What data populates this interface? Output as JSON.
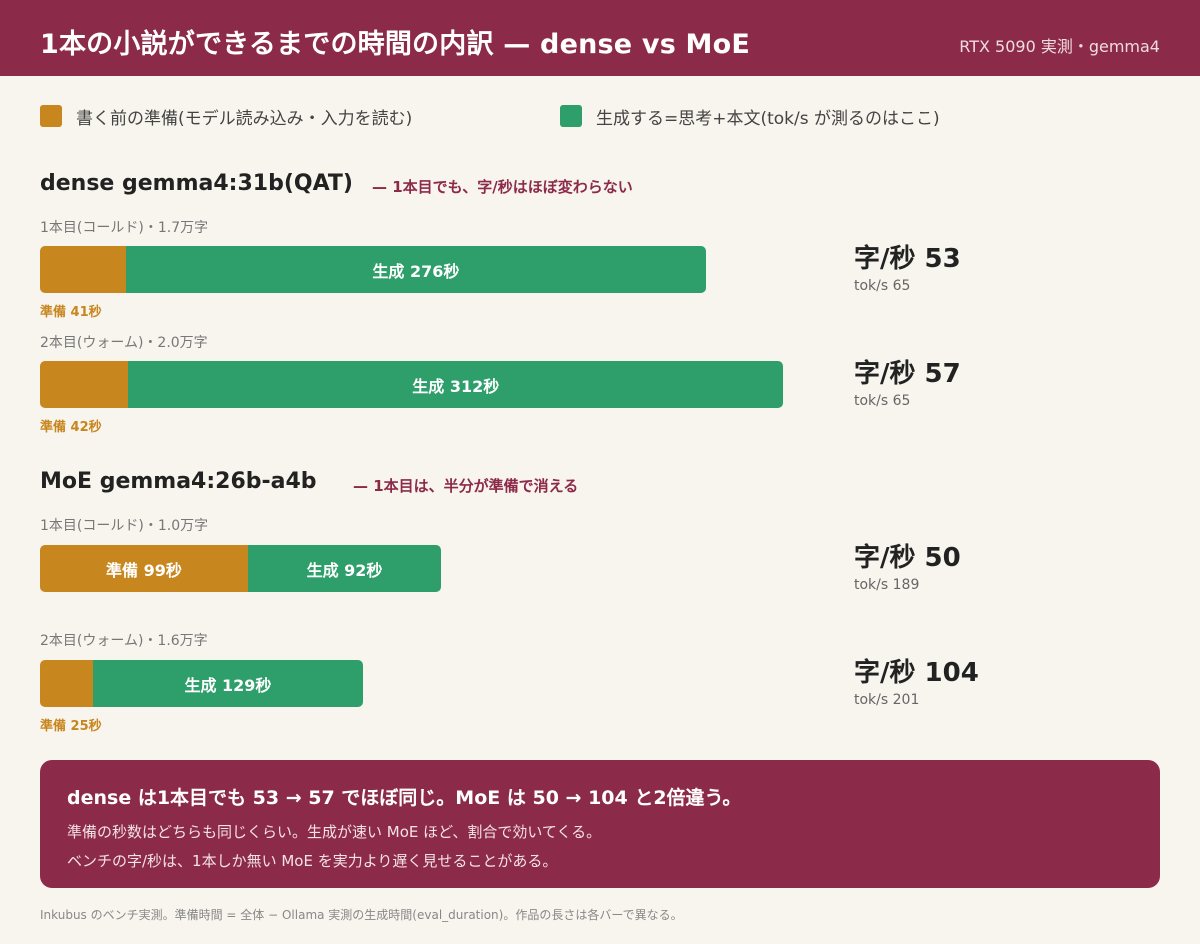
{
  "header": {
    "title": "1本の小説ができるまでの時間の内訳 — dense vs MoE",
    "subtitle": "RTX 5090 実測・gemma4"
  },
  "legend": {
    "prep_label": "書く前の準備(モデル読み込み・入力を読む)",
    "gen_label": "生成する=思考+本文(tok/s が測るのはここ)"
  },
  "colors": {
    "prep": "#c8861e",
    "gen": "#2e9e6b",
    "accent": "#8c2a4a",
    "background": "#f8f4ee"
  },
  "sections": [
    {
      "title": "dense gemma4:31b(QAT)",
      "note": "— 1本目でも、字/秒はほぼ変わらない",
      "runs": [
        {
          "label": "1本目(コールド)・1.7万字",
          "prep_text": "準備 41秒",
          "gen_text": "生成 276秒",
          "cps_text": "字/秒 53",
          "toks_text": "tok/s 65"
        },
        {
          "label": "2本目(ウォーム)・2.0万字",
          "prep_text": "準備 42秒",
          "gen_text": "生成 312秒",
          "cps_text": "字/秒 57",
          "toks_text": "tok/s 65"
        }
      ]
    },
    {
      "title": "MoE gemma4:26b-a4b",
      "note": "— 1本目は、半分が準備で消える",
      "runs": [
        {
          "label": "1本目(コールド)・1.0万字",
          "prep_text": "準備 99秒",
          "gen_text": "生成 92秒",
          "cps_text": "字/秒 50",
          "toks_text": "tok/s 189"
        },
        {
          "label": "2本目(ウォーム)・1.6万字",
          "prep_text": "準備 25秒",
          "gen_text": "生成 129秒",
          "cps_text": "字/秒 104",
          "toks_text": "tok/s 201"
        }
      ]
    }
  ],
  "chart_data": {
    "type": "bar",
    "stacked": true,
    "orientation": "horizontal",
    "categories": [
      "dense 1本目(コールド)",
      "dense 2本目(ウォーム)",
      "MoE 1本目(コールド)",
      "MoE 2本目(ウォーム)"
    ],
    "series": [
      {
        "name": "書く前の準備(モデル読み込み・入力を読む)",
        "values": [
          41,
          42,
          99,
          25
        ]
      },
      {
        "name": "生成する=思考+本文(tok/s が測るのはここ)",
        "values": [
          276,
          312,
          92,
          129
        ]
      }
    ],
    "chars_per_sec": [
      53,
      57,
      50,
      104
    ],
    "tok_per_sec": [
      65,
      65,
      189,
      201
    ],
    "characters": [
      "1.7万字",
      "2.0万字",
      "1.0万字",
      "1.6万字"
    ],
    "legend_position": "top",
    "grid": false
  },
  "callout": {
    "line1": "dense は1本目でも 53 → 57 でほぼ同じ。MoE は 50 → 104 と2倍違う。",
    "line2": "準備の秒数はどちらも同じくらい。生成が速い MoE ほど、割合で効いてくる。",
    "line3": "ベンチの字/秒は、1本しか無い MoE を実力より遅く見せることがある。"
  },
  "footnote": "Inkubus のベンチ実測。準備時間 = 全体 − Ollama 実測の生成時間(eval_duration)。作品の長さは各バーで異なる。"
}
